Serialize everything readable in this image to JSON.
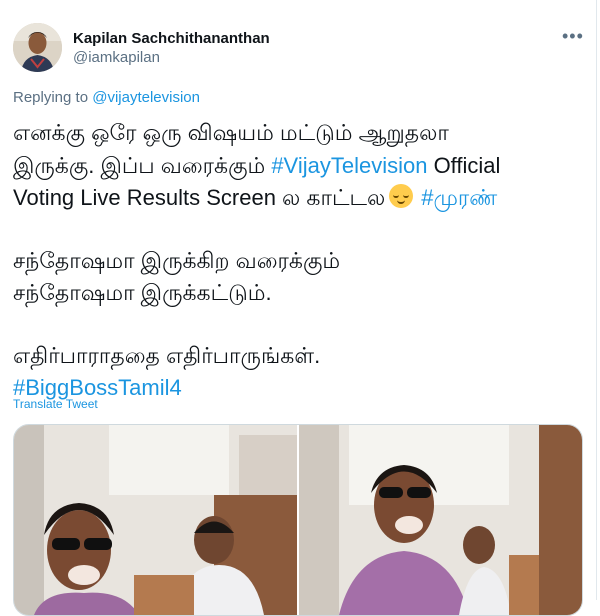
{
  "author": {
    "name": "Kapilan Sachchithananthan",
    "handle": "@iamkapilan"
  },
  "reply": {
    "prefix": "Replying to",
    "mention": "@vijaytelevision"
  },
  "tweet": {
    "line1": "எனக்கு ஒரே ஒரு விஷயம் மட்டும் ஆறுதலா",
    "line2_a": "இருக்கு. இப்ப வரைக்கும் ",
    "line2_tag": "#VijayTelevision",
    "line2_b": " Official",
    "line3_a": "Voting Live Results Screen ல காட்டல",
    "line3_tag": "#முரண்",
    "line4": "சந்தோஷமா இருக்கிற வரைக்கும்",
    "line5": "சந்தோஷமா இருக்கட்டும்.",
    "line6": "எதிர்பாராததை எதிர்பாருங்கள்.",
    "line7_tag": "#BiggBossTamil4"
  },
  "translate_label": "Translate Tweet",
  "icons": {
    "more": "more-dots-icon",
    "emoji": "relieved-face-emoji"
  },
  "colors": {
    "link": "#1b95e0",
    "secondary_text": "#5b7083",
    "primary_text": "#0f1419"
  }
}
